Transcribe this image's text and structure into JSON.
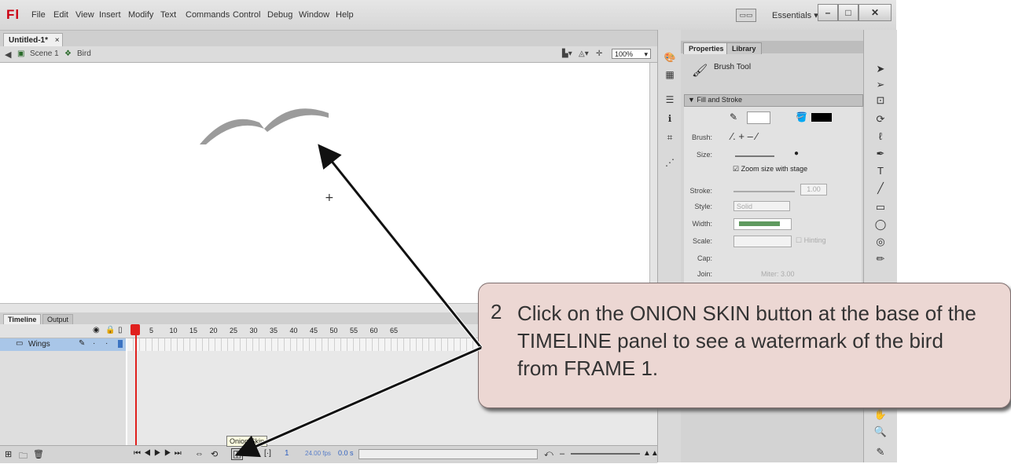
{
  "menubar": {
    "logo": "Fl",
    "items": [
      "File",
      "Edit",
      "View",
      "Insert",
      "Modify",
      "Text",
      "Commands",
      "Control",
      "Debug",
      "Window",
      "Help"
    ],
    "workspace": "Essentials",
    "window_buttons": [
      "–",
      "□",
      "✕"
    ]
  },
  "document": {
    "tab_label": "Untitled-1*",
    "tab_close": "×",
    "scene": "Scene 1",
    "symbol": "Bird",
    "zoom": "100%"
  },
  "timeline": {
    "tabs": [
      "Timeline",
      "Output"
    ],
    "layer_name": "Wings",
    "frame_numbers": [
      "5",
      "10",
      "15",
      "20",
      "25",
      "30",
      "35",
      "40",
      "45",
      "50",
      "55",
      "60",
      "65"
    ],
    "tooltip": "Onion Skin",
    "status_frame": "1",
    "status_fps": "24.00 fps",
    "status_time": "0.0 s"
  },
  "properties": {
    "tabs": [
      "Properties",
      "Library"
    ],
    "tool_name": "Brush Tool",
    "section": "Fill and Stroke",
    "brush_label": "Brush:",
    "size_label": "Size:",
    "zoom_checkbox": "Zoom size with stage",
    "stroke_label": "Stroke:",
    "stroke_value": "1.00",
    "style_label": "Style:",
    "style_value": "Solid",
    "width_label": "Width:",
    "scale_label": "Scale:",
    "hinting_label": "Hinting",
    "cap_label": "Cap:",
    "join_label": "Join:",
    "miter_label": "Miter:",
    "miter_value": "3.00"
  },
  "callout": {
    "number": "2",
    "text": "Click on the ONION SKIN button at the base of the TIMELINE panel to see a watermark of the bird from FRAME 1."
  },
  "colors": {
    "callout_bg": "#ecd7d3",
    "playhead": "#e0201e",
    "layer_highlight": "#a9c6e8",
    "fill_color": "#000000",
    "width_bar": "#5f9a5f"
  },
  "icons": [
    "scene-icon",
    "symbol-icon",
    "eye-icon",
    "lock-icon",
    "outline-icon",
    "pencil-icon",
    "onion-skin-icon",
    "arrow-icon",
    "brush-icon",
    "paint-bucket-icon",
    "hand-icon",
    "zoom-icon",
    "text-tool-icon"
  ]
}
